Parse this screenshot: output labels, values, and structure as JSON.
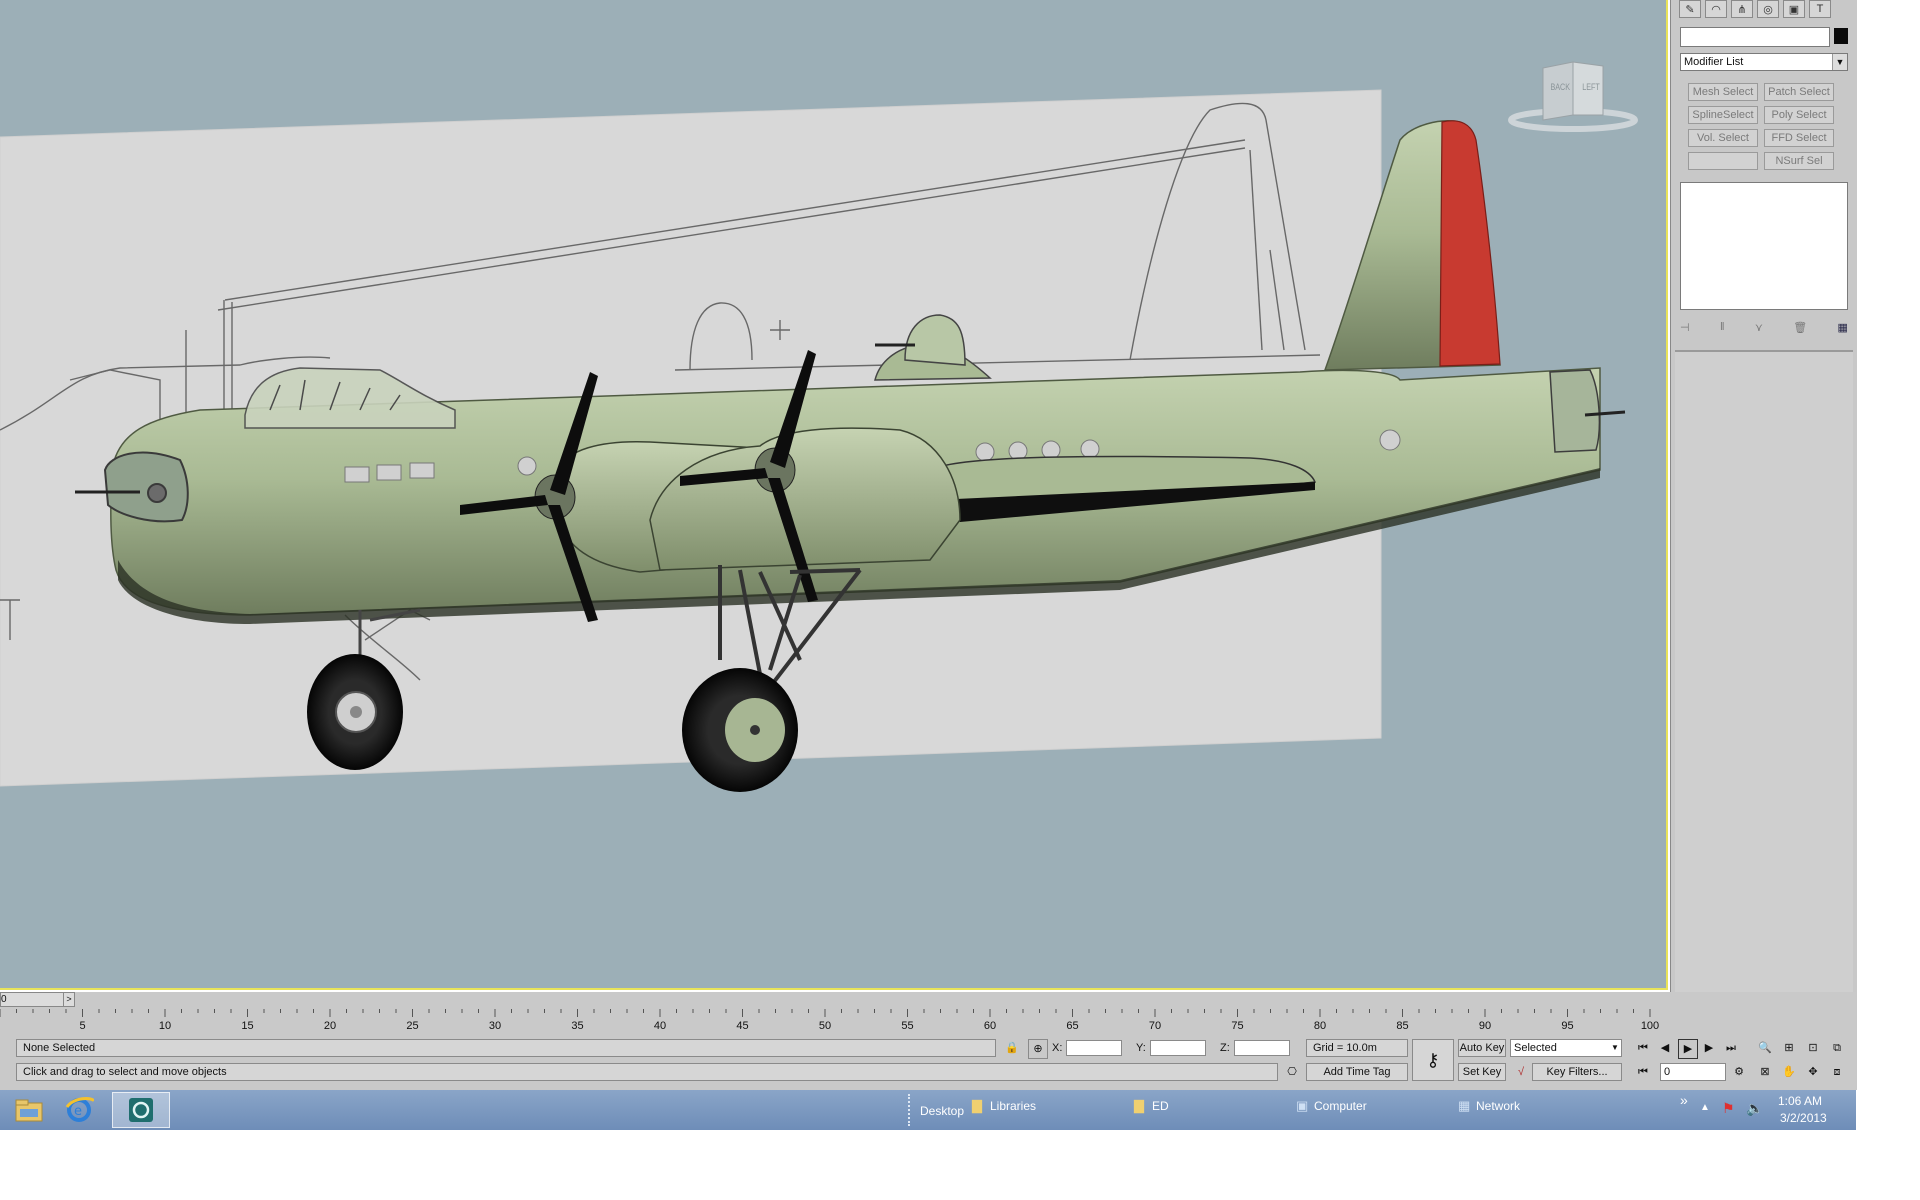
{
  "viewport": {
    "viewcube": {
      "back_label": "BACK",
      "left_label": "LEFT"
    }
  },
  "command_panel": {
    "tabs": [
      "create-icon",
      "modify-icon",
      "hierarchy-icon",
      "motion-icon",
      "display-icon",
      "utilities-icon"
    ],
    "modifier_list": "Modifier List",
    "modifier_buttons": [
      "Mesh Select",
      "Patch Select",
      "SplineSelect",
      "Poly Select",
      "Vol. Select",
      "FFD Select",
      "",
      "NSurf Sel"
    ]
  },
  "time": {
    "slider_value": "0",
    "slider_arrow": ">",
    "ticks": [
      "5",
      "10",
      "15",
      "20",
      "25",
      "30",
      "35",
      "40",
      "45",
      "50",
      "55",
      "60",
      "65",
      "70",
      "75",
      "80",
      "85",
      "90",
      "95",
      "100"
    ]
  },
  "status": {
    "selection": "None Selected",
    "prompt": "Click and drag to select and move objects",
    "x_label": "X:",
    "y_label": "Y:",
    "z_label": "Z:",
    "grid": "Grid = 10.0m",
    "add_time_tag": "Add Time Tag",
    "auto_key": "Auto Key",
    "set_key": "Set Key",
    "key_filters": "Key Filters...",
    "selected_dropdown": "Selected",
    "current_frame": "0"
  },
  "taskbar": {
    "toolbars": [
      {
        "label": "Desktop",
        "icon": ""
      },
      {
        "label": "Libraries",
        "icon": "folder-icon"
      },
      {
        "label": "ED",
        "icon": "folder-icon"
      },
      {
        "label": "Computer",
        "icon": "computer-icon"
      },
      {
        "label": "Network",
        "icon": "network-icon"
      }
    ],
    "overflow": "»",
    "time": "1:06 AM",
    "date": "3/2/2013"
  },
  "colors": {
    "viewport_bg": "#9cafb7",
    "aircraft_body": "#a9ba94",
    "rudder": "#c83a30",
    "panel_bg": "#c8c8c8",
    "taskbar": "#7995bf",
    "viewport_border": "#e8e35a"
  }
}
